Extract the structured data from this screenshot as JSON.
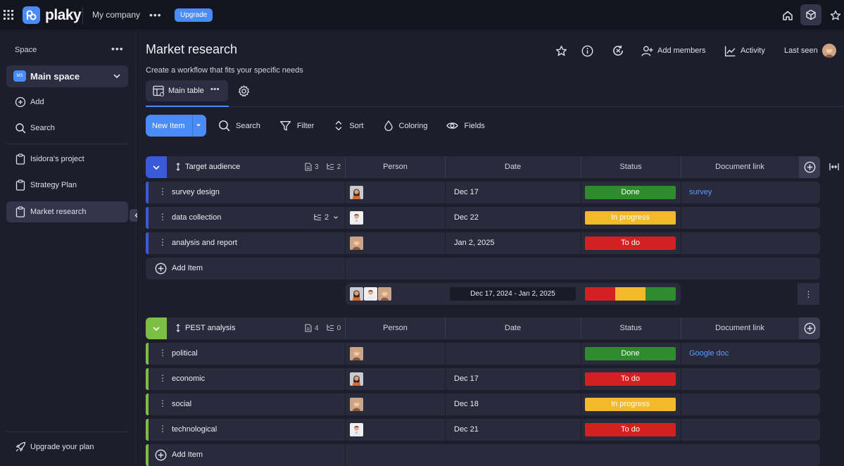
{
  "topbar": {
    "brand": "plaky",
    "company": "My company",
    "more": "•••",
    "upgrade": "Upgrade"
  },
  "sidebar": {
    "space_label": "Space",
    "space_more": "•••",
    "main_space": {
      "badge": "MS",
      "label": "Main space"
    },
    "actions": [
      {
        "label": "Add",
        "icon": "plus-circle-icon"
      },
      {
        "label": "Search",
        "icon": "search-icon"
      }
    ],
    "boards": [
      {
        "label": "Isidora's project",
        "icon": "clipboard-icon"
      },
      {
        "label": "Strategy Plan",
        "icon": "clipboard-icon"
      },
      {
        "label": "Market research",
        "icon": "clipboard-icon",
        "active": true
      }
    ],
    "upgrade_plan": "Upgrade your plan"
  },
  "header": {
    "title": "Market research",
    "subtitle": "Create a workflow that fits your specific needs",
    "add_members": "Add members",
    "activity": "Activity",
    "last_seen": "Last seen"
  },
  "view": {
    "tab_label": "Main table",
    "tab_more": "•••"
  },
  "toolbar": {
    "new_item": "New Item",
    "search": "Search",
    "filter": "Filter",
    "sort": "Sort",
    "coloring": "Coloring",
    "fields": "Fields"
  },
  "columns": {
    "person": "Person",
    "date": "Date",
    "status": "Status",
    "document_link": "Document link"
  },
  "colors": {
    "accent": "#4a8cf7",
    "group1": "#3a5bd9",
    "group2": "#7bc043",
    "done": "#2e8b2e",
    "in_progress": "#f2b92a",
    "to_do": "#d42020",
    "link": "#5a9cff"
  },
  "groups": [
    {
      "name": "Target audience",
      "docs_count": "3",
      "subitems_count": "2",
      "items": [
        {
          "name": "survey design",
          "date": "Dec 17",
          "status": "Done",
          "doc": "survey",
          "person": "woman-dark"
        },
        {
          "name": "data collection",
          "subitems": "2",
          "date": "Dec 22",
          "status": "In progress",
          "doc": "",
          "person": "man"
        },
        {
          "name": "analysis and report",
          "date": "Jan 2, 2025",
          "status": "To do",
          "doc": "",
          "person": "woman-blonde"
        }
      ],
      "add_item": "Add Item",
      "summary": {
        "date_range": "Dec 17, 2024 - Jan 2, 2025",
        "more": "⋮",
        "status_breakdown": [
          {
            "status": "To do",
            "fraction": 0.333
          },
          {
            "status": "In progress",
            "fraction": 0.333
          },
          {
            "status": "Done",
            "fraction": 0.334
          }
        ]
      }
    },
    {
      "name": "PEST analysis",
      "docs_count": "4",
      "subitems_count": "0",
      "items": [
        {
          "name": "political",
          "date": "",
          "status": "Done",
          "doc": "Google doc",
          "person": "woman-blonde"
        },
        {
          "name": "economic",
          "date": "Dec 17",
          "status": "To do",
          "doc": "",
          "person": "woman-dark"
        },
        {
          "name": "social",
          "date": "Dec 18",
          "status": "In progress",
          "doc": "",
          "person": "woman-blonde"
        },
        {
          "name": "technological",
          "date": "Dec 21",
          "status": "To do",
          "doc": "",
          "person": "man"
        }
      ],
      "add_item": "Add Item"
    }
  ]
}
